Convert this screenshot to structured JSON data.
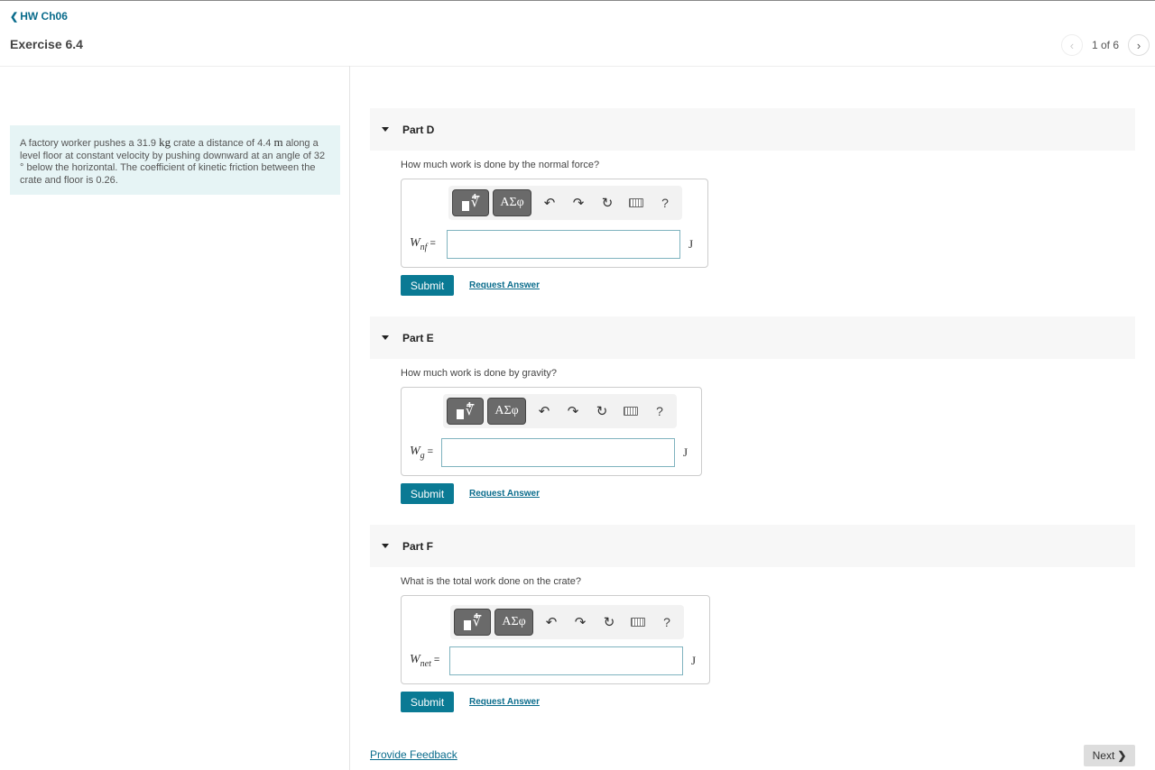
{
  "nav": {
    "back_label": "HW Ch06",
    "exercise_title": "Exercise 6.4",
    "pager_text": "1 of 6"
  },
  "problem": {
    "t1": "A factory worker pushes a 31.9 ",
    "u1": "kg",
    "t2": " crate a distance of 4.4 ",
    "u2": "m",
    "t3": " along a level floor at constant velocity by pushing downward at an angle of 32 ° below the horizontal. The coefficient of kinetic friction between the crate and floor is 0.26."
  },
  "toolbar": {
    "greek_label": "ΑΣφ",
    "help_label": "?"
  },
  "parts": [
    {
      "title": "Part D",
      "question": "How much work is done by the normal force?",
      "var": "W",
      "sub": "nf",
      "unit": "J",
      "value": ""
    },
    {
      "title": "Part E",
      "question": "How much work is done by gravity?",
      "var": "W",
      "sub": "g",
      "unit": "J",
      "value": ""
    },
    {
      "title": "Part F",
      "question": "What is the total work done on the crate?",
      "var": "W",
      "sub": "net",
      "unit": "J",
      "value": ""
    }
  ],
  "actions": {
    "submit_label": "Submit",
    "request_label": "Request Answer"
  },
  "footer": {
    "feedback_label": "Provide Feedback",
    "next_label": "Next"
  }
}
